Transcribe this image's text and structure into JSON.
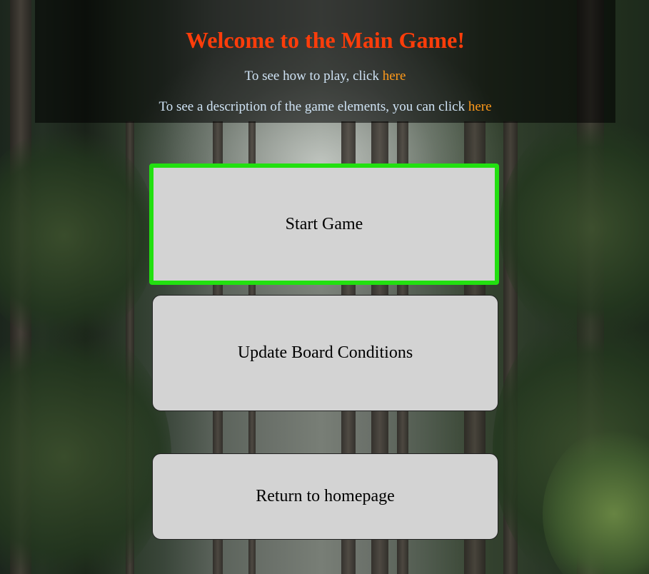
{
  "header": {
    "title": "Welcome to the Main Game!",
    "how_to_play_prefix": "To see how to play, click ",
    "how_to_play_link": "here",
    "description_prefix": "To see a description of the game elements, you can click ",
    "description_link": "here"
  },
  "buttons": {
    "start_game": "Start Game",
    "update_board": "Update Board Conditions",
    "return_home": "Return to homepage"
  },
  "colors": {
    "title": "#ff3d0a",
    "link": "#ff9a1a",
    "start_highlight": "#22e010",
    "button_bg": "#d3d3d3"
  }
}
